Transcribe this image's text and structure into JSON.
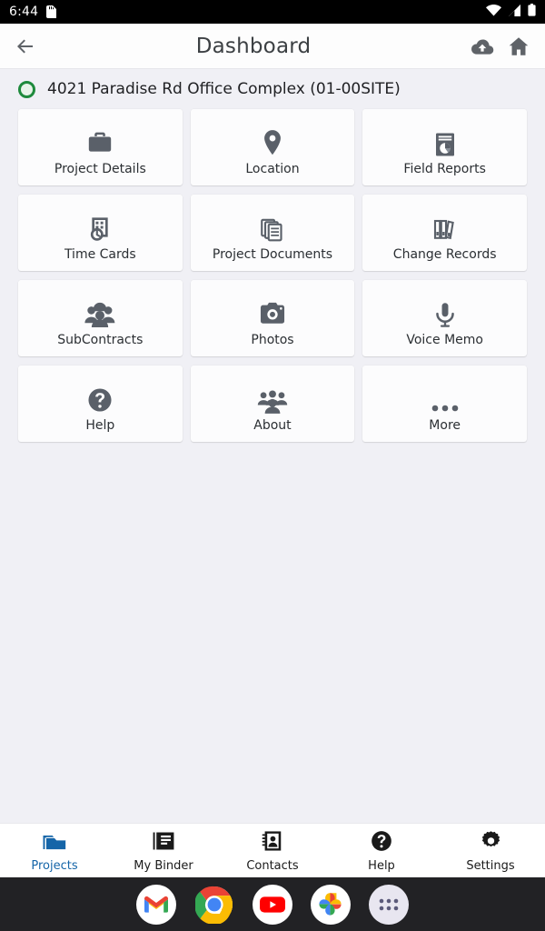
{
  "status_bar": {
    "time": "6:44",
    "icons": [
      "sd-card-icon",
      "wifi-icon",
      "cellular-signal-icon",
      "battery-icon"
    ]
  },
  "app_bar": {
    "back_icon": "back-arrow-icon",
    "title": "Dashboard",
    "actions": [
      {
        "name": "cloud-upload-icon",
        "label": "Cloud Sync"
      },
      {
        "name": "home-icon",
        "label": "Home"
      }
    ]
  },
  "project_header": {
    "status_color": "#1e8a3c",
    "name": "4021 Paradise Rd Office Complex  (01-00SITE)"
  },
  "grid": {
    "tiles": [
      {
        "label": "Project Details",
        "icon": "briefcase-icon"
      },
      {
        "label": "Location",
        "icon": "map-pin-icon"
      },
      {
        "label": "Field Reports",
        "icon": "report-chart-icon"
      },
      {
        "label": "Time Cards",
        "icon": "time-clock-icon"
      },
      {
        "label": "Project Documents",
        "icon": "documents-stack-icon"
      },
      {
        "label": "Change Records",
        "icon": "binders-icon"
      },
      {
        "label": "SubContracts",
        "icon": "workers-hardhat-icon"
      },
      {
        "label": "Photos",
        "icon": "camera-icon"
      },
      {
        "label": "Voice Memo",
        "icon": "microphone-icon"
      },
      {
        "label": "Help",
        "icon": "question-circle-icon"
      },
      {
        "label": "About",
        "icon": "people-group-icon"
      },
      {
        "label": "More",
        "icon": "ellipsis-icon"
      }
    ]
  },
  "bottom_nav": {
    "active_color": "#1565a8",
    "items": [
      {
        "label": "Projects",
        "icon": "folder-icon",
        "active": true
      },
      {
        "label": "My Binder",
        "icon": "binder-icon",
        "active": false
      },
      {
        "label": "Contacts",
        "icon": "contacts-icon",
        "active": false
      },
      {
        "label": "Help",
        "icon": "help-circle-icon",
        "active": false
      },
      {
        "label": "Settings",
        "icon": "gear-icon",
        "active": false
      }
    ]
  },
  "dock": {
    "apps": [
      {
        "name": "gmail-icon",
        "label": "Gmail"
      },
      {
        "name": "chrome-icon",
        "label": "Chrome"
      },
      {
        "name": "youtube-icon",
        "label": "YouTube"
      },
      {
        "name": "google-photos-icon",
        "label": "Photos"
      },
      {
        "name": "app-drawer-icon",
        "label": "All apps"
      }
    ]
  }
}
